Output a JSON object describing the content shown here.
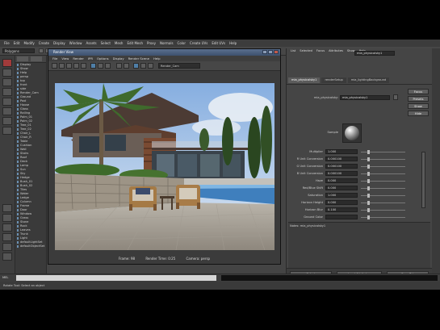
{
  "app": {
    "main_menu": [
      "File",
      "Edit",
      "Modify",
      "Create",
      "Display",
      "Window",
      "Assets",
      "Select",
      "Mesh",
      "Edit Mesh",
      "Proxy",
      "Normals",
      "Color",
      "Create UVs",
      "Edit UVs",
      "Help"
    ],
    "mode_dropdown": "Polygons"
  },
  "outliner": {
    "items": [
      "Display",
      "Show",
      "Help",
      "persp",
      "top",
      "front",
      "side",
      "Render_Cam",
      "Ground",
      "Pool",
      "House",
      "Glass",
      "Railing",
      "Palm_01",
      "Palm_02",
      "Tree_01",
      "Tree_02",
      "Chair_L",
      "Chair_R",
      "Table",
      "Cushion",
      "Wall",
      "Stairs",
      "Roof",
      "Deck",
      "Lamp",
      "Sun",
      "Sky",
      "Hedge",
      "Bush_01",
      "Bush_02",
      "Tiles",
      "Water",
      "Ledge",
      "Column",
      "Frame",
      "Door",
      "Window",
      "Grass",
      "Stone",
      "Rock",
      "Leaves",
      "Trunk",
      "Light",
      "defaultLightSet",
      "defaultObjectSet"
    ]
  },
  "render_view": {
    "title": "Render View",
    "menu": [
      "File",
      "View",
      "Render",
      "IPR",
      "Options",
      "Display",
      "Render Scene",
      "Help"
    ],
    "camera_dropdown": "Render_Cam",
    "status": {
      "frame": "Frame: 98",
      "render_time": "Render Time: 0:25",
      "camera": "Camera: persp"
    }
  },
  "attribute_editor": {
    "menu": [
      "List",
      "Selected",
      "Focus",
      "Attributes",
      "Show",
      "Help"
    ],
    "header_field": "mia_physicalsky1",
    "tabs": [
      "mia_physicalsky1",
      "renderSetup",
      "mia_lightingBackground"
    ],
    "node_label": "mia_physicalsky:",
    "node_value": "mia_physicalsky1",
    "focus_button": "Focus",
    "presets_button": "Presets",
    "show_button": "Show",
    "hide_button": "Hide",
    "sample_label": "Sample",
    "attributes": [
      {
        "label": "Multiplier",
        "value": "1.000"
      },
      {
        "label": "R Unit Conversion",
        "value": "0.000100"
      },
      {
        "label": "G Unit Conversion",
        "value": "0.000100"
      },
      {
        "label": "B Unit Conversion",
        "value": "0.000100"
      },
      {
        "label": "Haze",
        "value": "0.000"
      },
      {
        "label": "Red/Blue Shift",
        "value": "0.000"
      },
      {
        "label": "Saturation",
        "value": "1.000"
      },
      {
        "label": "Horizon Height",
        "value": "0.000"
      },
      {
        "label": "Horizon Blur",
        "value": "0.100"
      },
      {
        "label": "Ground Color",
        "value": ""
      }
    ],
    "notes_label": "Notes: mia_physicalsky1",
    "buttons": {
      "select": "Select",
      "load": "Load Attributes",
      "copy": "Copy Tab"
    }
  },
  "help_line": "Rotate Tool: Select an object"
}
